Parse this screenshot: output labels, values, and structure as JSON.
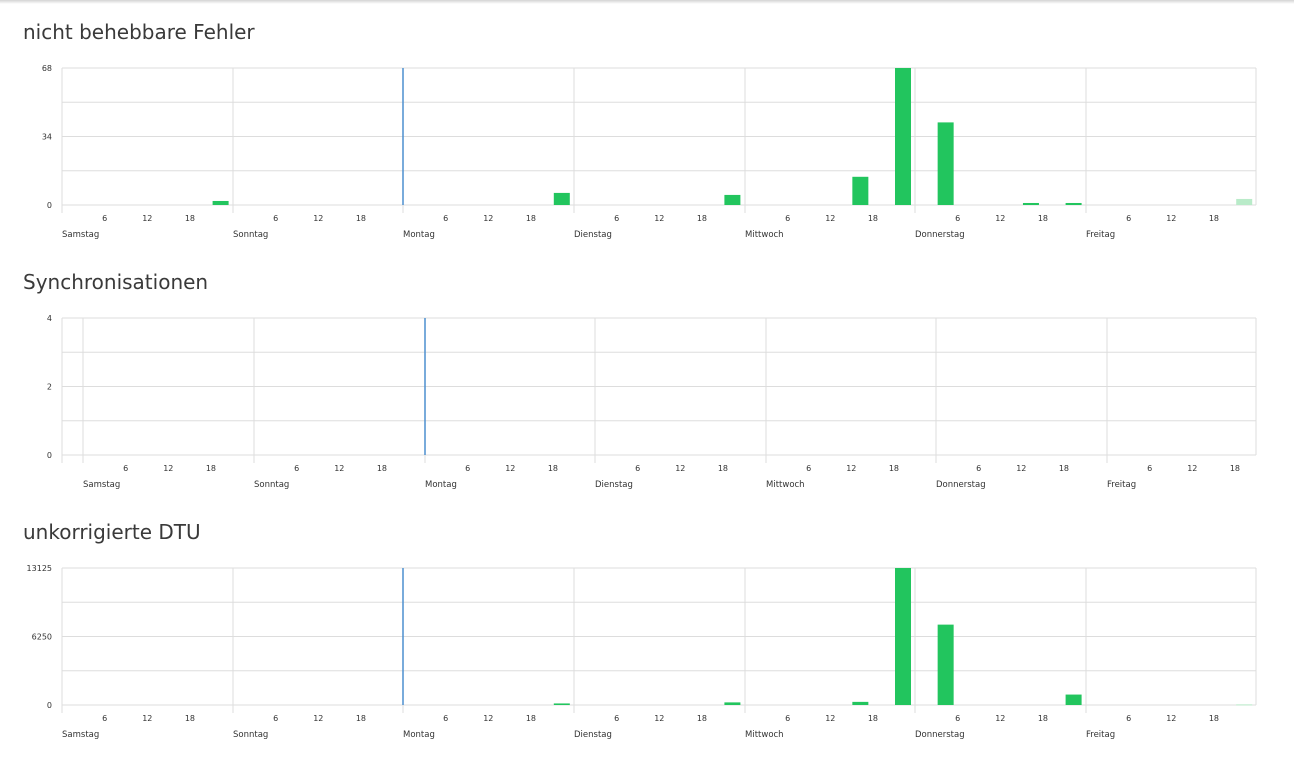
{
  "days": [
    "Samstag",
    "Sonntag",
    "Montag",
    "Dienstag",
    "Mittwoch",
    "Donnerstag",
    "Freitag"
  ],
  "hour_ticks": [
    "6",
    "12",
    "18"
  ],
  "colors": {
    "bar": "#22c55e",
    "bar_pending": "#b9ebc9",
    "now_line": "#4d8fcf",
    "grid": "#dddddd"
  },
  "charts": [
    {
      "title": "nicht behebbare Fehler",
      "chart_data": {
        "type": "bar",
        "x_unit": "hour blocks (6 h) over 7 days",
        "ylim": [
          0,
          68
        ],
        "y_ticks": [
          "68",
          "34",
          "0"
        ],
        "grid": true,
        "values": [
          0,
          0,
          0,
          2,
          0,
          0,
          0,
          0,
          0,
          0,
          0,
          6,
          0,
          0,
          0,
          5,
          0,
          0,
          14,
          68,
          41,
          0,
          1,
          1,
          0,
          0,
          0,
          3
        ],
        "pending_index": 27
      }
    },
    {
      "title": "Synchronisationen",
      "chart_data": {
        "type": "bar",
        "x_unit": "hour blocks (6 h) over 7 days",
        "ylim": [
          0,
          4
        ],
        "y_ticks": [
          "4",
          "2",
          "0"
        ],
        "grid": true,
        "values": [
          0,
          0,
          0,
          0,
          0,
          0,
          0,
          0,
          0,
          0,
          0,
          0,
          0,
          0,
          0,
          0,
          0,
          0,
          0,
          0,
          0,
          0,
          0,
          0,
          0,
          0,
          0,
          0
        ],
        "pending_index": null
      }
    },
    {
      "title": "unkorrigierte DTU",
      "chart_data": {
        "type": "bar",
        "x_unit": "hour blocks (6 h) over 7 days",
        "ylim": [
          0,
          13125
        ],
        "y_ticks": [
          "13125",
          "6250",
          "0"
        ],
        "grid": true,
        "values": [
          0,
          0,
          0,
          0,
          0,
          0,
          0,
          0,
          0,
          0,
          0,
          150,
          0,
          0,
          0,
          250,
          0,
          0,
          300,
          13125,
          7700,
          0,
          0,
          1000,
          0,
          0,
          0,
          60
        ],
        "pending_index": 27
      }
    }
  ]
}
